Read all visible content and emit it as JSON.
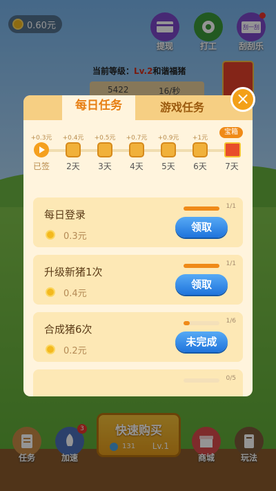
{
  "hud": {
    "coin_balance": "0.60元",
    "buttons": [
      {
        "label": "提现",
        "icon": "withdraw-card-icon"
      },
      {
        "label": "打工",
        "icon": "work-icon"
      },
      {
        "label": "刮刮乐",
        "icon": "scratch-card-icon",
        "card_text": "刮一刮"
      }
    ]
  },
  "game": {
    "level_prefix": "当前等级：",
    "level": "Lv.2",
    "level_name": "和谐福猪",
    "total_count": "5422",
    "rate": "16/秒"
  },
  "modal": {
    "tabs": [
      "每日任务",
      "游戏任务"
    ],
    "active_tab": 0,
    "chest_tag": "宝箱",
    "days": [
      {
        "amount": "+0.3元",
        "label": "已签",
        "state": "signed"
      },
      {
        "amount": "+0.4元",
        "label": "2天"
      },
      {
        "amount": "+0.5元",
        "label": "3天"
      },
      {
        "amount": "+0.7元",
        "label": "4天"
      },
      {
        "amount": "+0.9元",
        "label": "5天"
      },
      {
        "amount": "+1元",
        "label": "6天"
      },
      {
        "amount": "",
        "label": "7天",
        "state": "chest"
      }
    ],
    "tasks": [
      {
        "name": "每日登录",
        "reward": "0.3元",
        "progress": "1/1",
        "progress_fraction": 1.0,
        "button": "领取"
      },
      {
        "name": "升级新猪1次",
        "reward": "0.4元",
        "progress": "1/1",
        "progress_fraction": 1.0,
        "button": "领取"
      },
      {
        "name": "合成猪6次",
        "reward": "0.2元",
        "progress": "1/6",
        "progress_fraction": 0.17,
        "button": "未完成"
      },
      {
        "name": "",
        "reward": "",
        "progress": "0/5",
        "progress_fraction": 0.0,
        "button": ""
      }
    ]
  },
  "bottom": {
    "left": [
      {
        "label": "任务",
        "icon": "task-list-icon"
      },
      {
        "label": "加速",
        "icon": "rocket-icon",
        "badge": "3"
      }
    ],
    "buy": {
      "label": "快速购买",
      "coins": "131",
      "level": "Lv.1"
    },
    "right": [
      {
        "label": "商城",
        "icon": "shop-icon"
      },
      {
        "label": "玩法",
        "icon": "book-icon"
      }
    ]
  },
  "colors": {
    "accent": "#f08a17",
    "button_blue": "#2b86e6",
    "modal_bg": "#fff4dd"
  }
}
